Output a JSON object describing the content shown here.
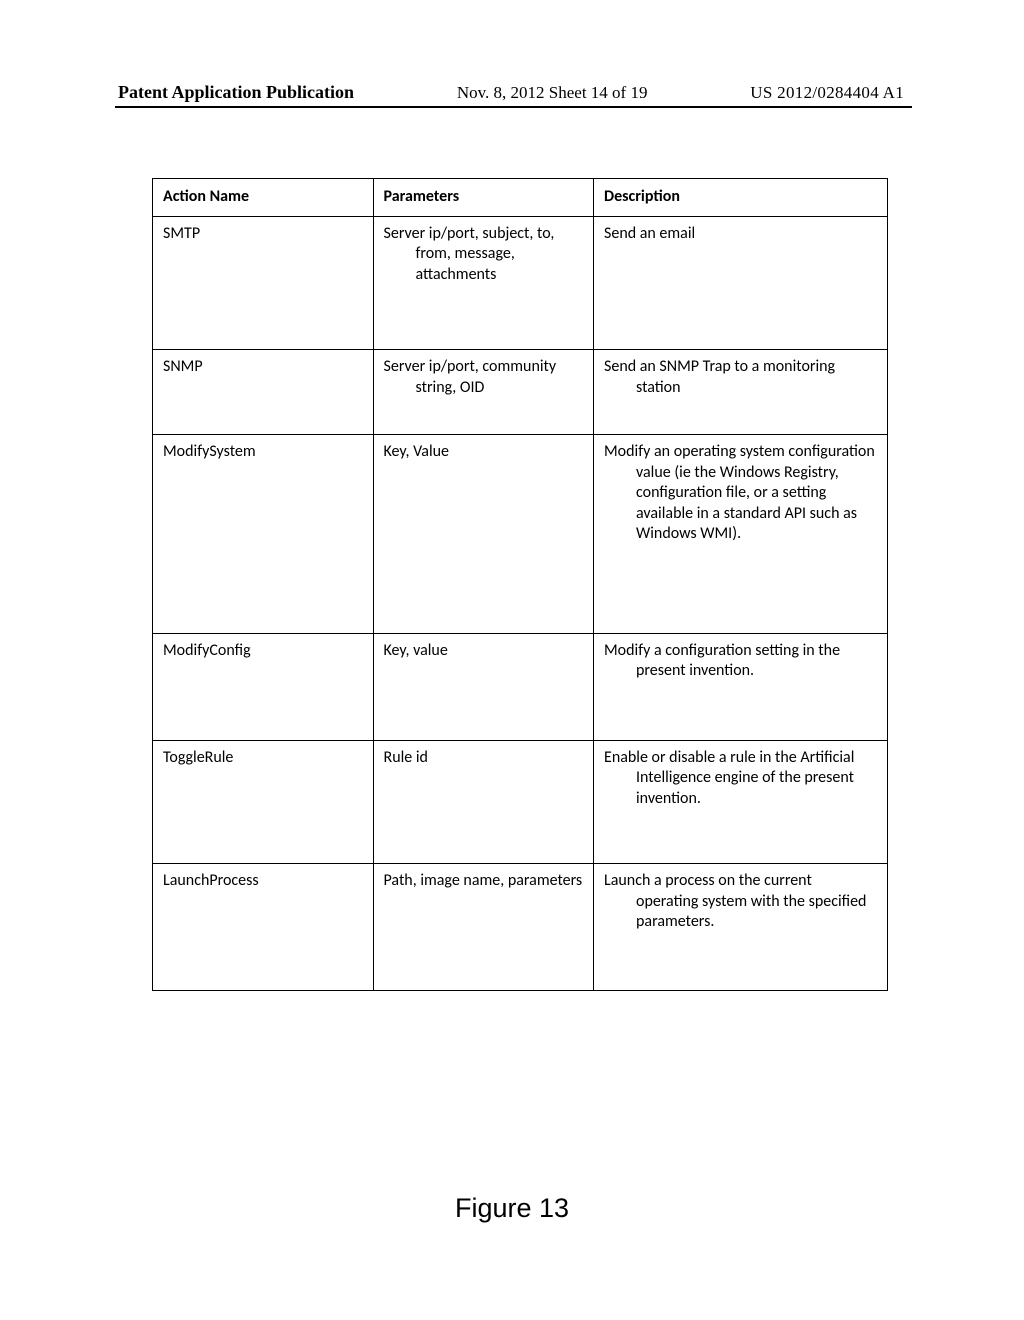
{
  "header": {
    "left": "Patent Application Publication",
    "center": "Nov. 8, 2012   Sheet 14 of 19",
    "right": "US 2012/0284404 A1"
  },
  "table": {
    "headers": {
      "action_name": "Action Name",
      "parameters": "Parameters",
      "description": "Description"
    },
    "rows": [
      {
        "action_name": "SMTP",
        "parameters": "Server ip/port, subject, to, from, message, attachments",
        "description": "Send an email"
      },
      {
        "action_name": "SNMP",
        "parameters": "Server ip/port, community string, OID",
        "description": "Send an SNMP Trap to a monitoring station"
      },
      {
        "action_name": "ModifySystem",
        "parameters": "Key, Value",
        "description": "Modify an operating system configuration value (ie the Windows Registry, configuration file, or a setting available in a standard API such as Windows WMI)."
      },
      {
        "action_name": "ModifyConfig",
        "parameters": "Key, value",
        "description": "Modify a configuration setting in the present invention."
      },
      {
        "action_name": "ToggleRule",
        "parameters": "Rule id",
        "description": "Enable or disable a rule in the Artificial Intelligence engine of the present invention."
      },
      {
        "action_name": "LaunchProcess",
        "parameters": "Path, image name, parameters",
        "description": "Launch a process on the current operating system with the specified parameters."
      }
    ]
  },
  "figure_caption": "Figure 13"
}
